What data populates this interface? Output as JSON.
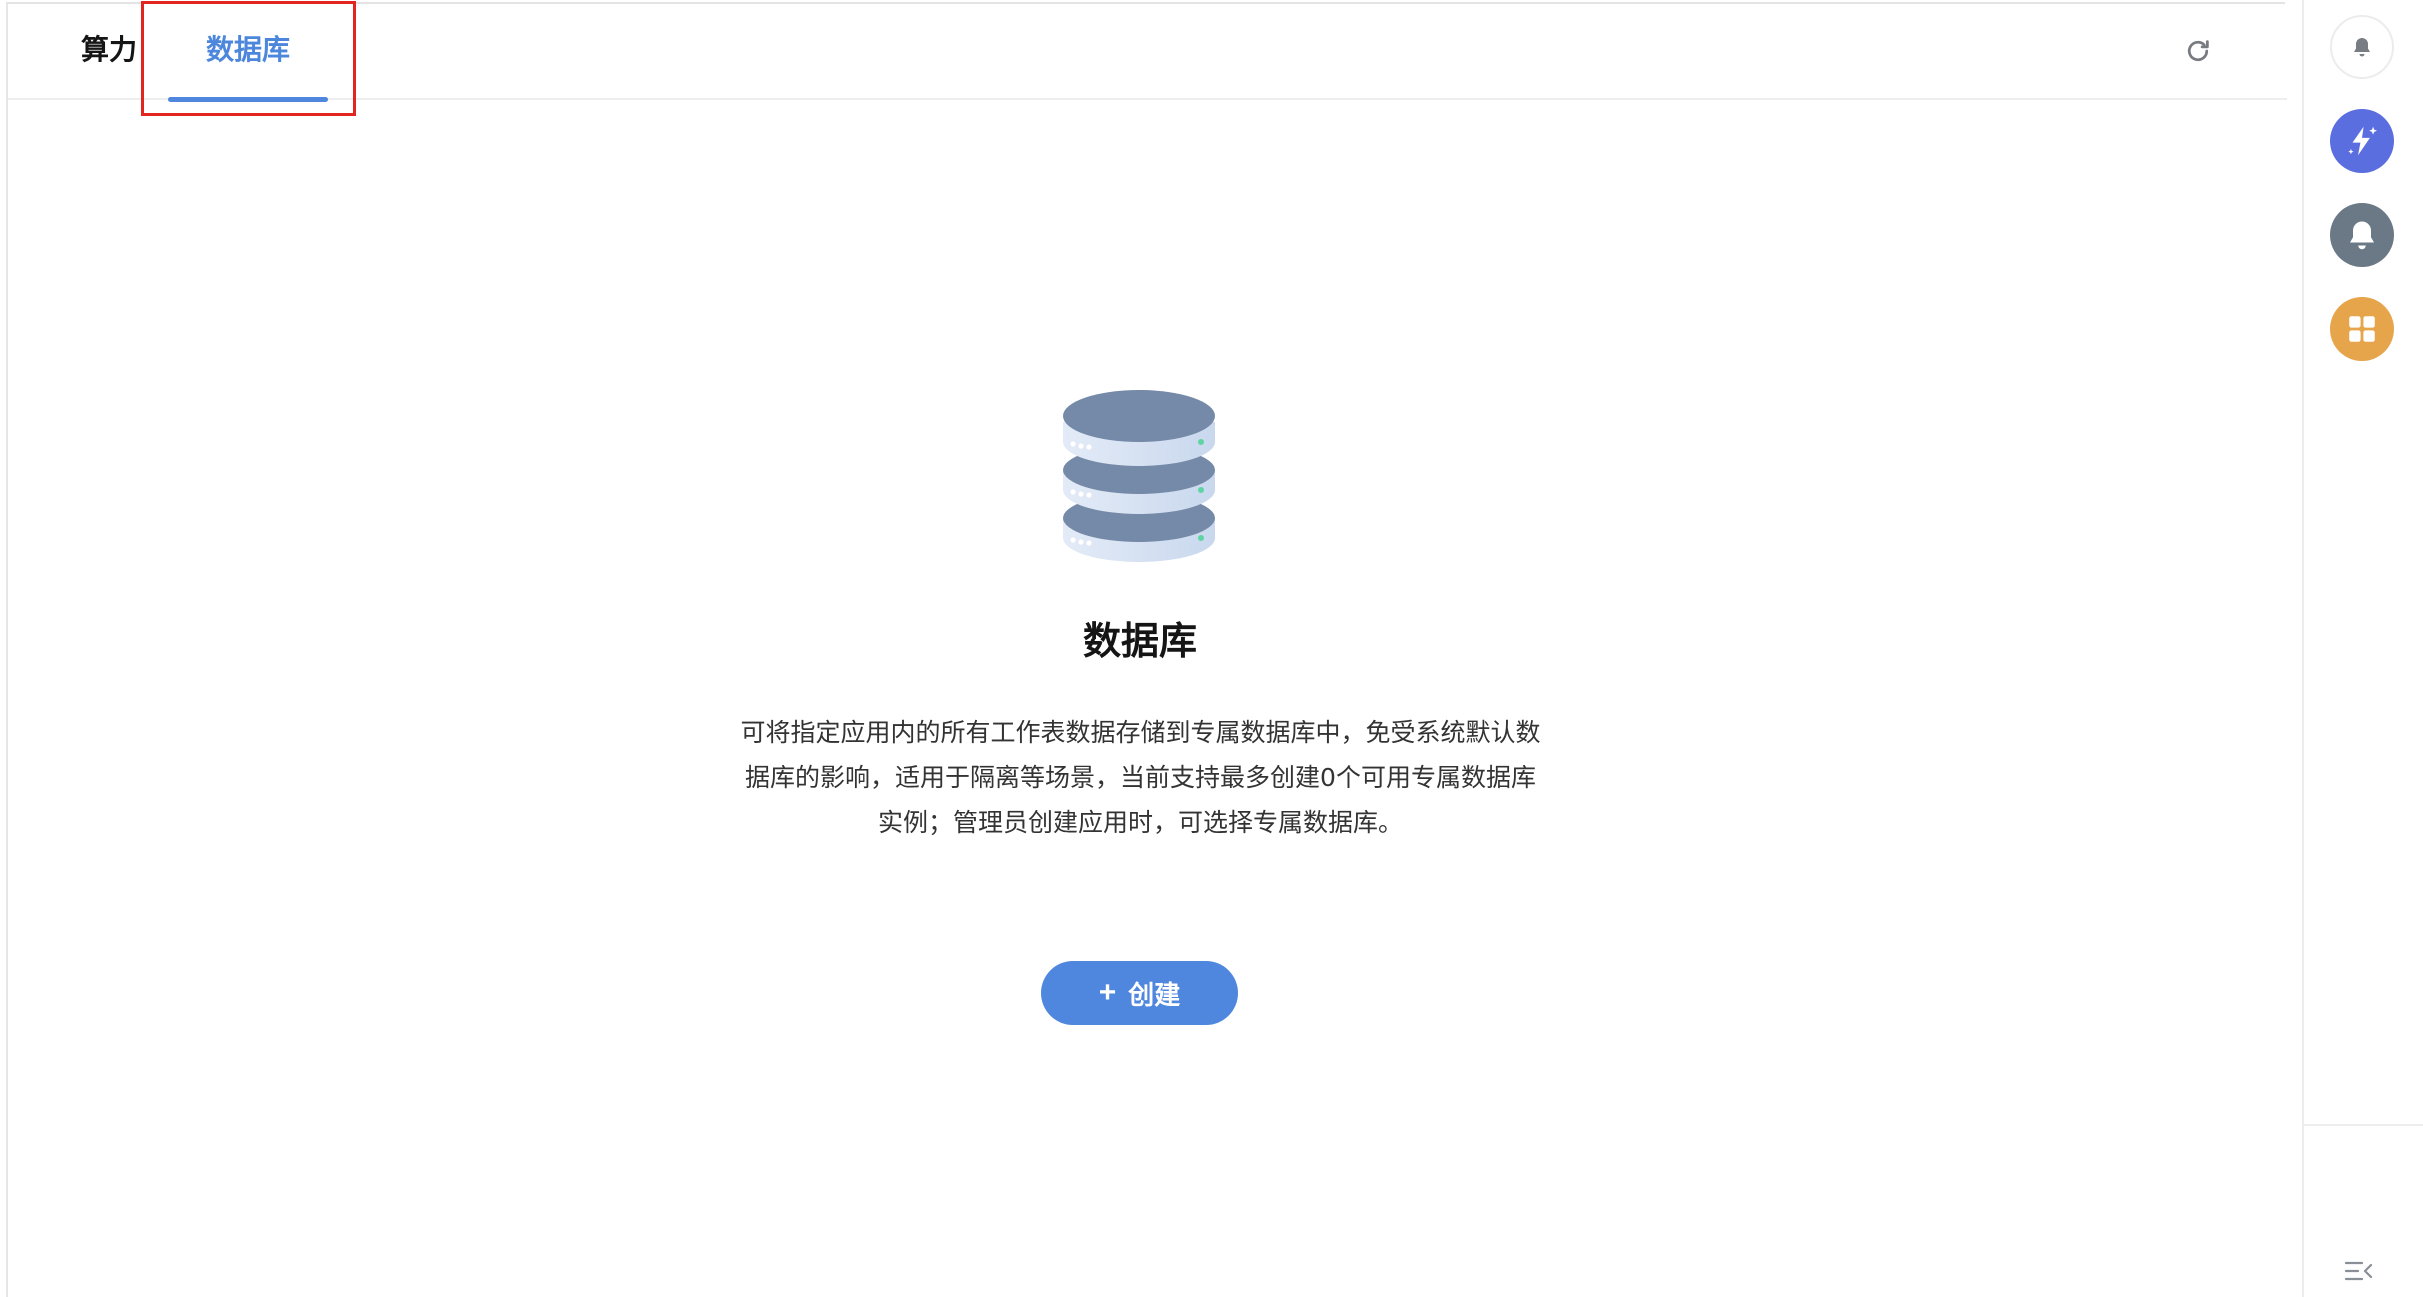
{
  "tabs": [
    {
      "label": "算力",
      "active": false
    },
    {
      "label": "数据库",
      "active": true
    }
  ],
  "empty_state": {
    "title": "数据库",
    "description_lines": [
      "可将指定应用内的所有工作表数据存储到专属数据库中，免受系统默认数",
      "据库的影响，适用于隔离等场景，当前支持最多创建0个可用专属数据库",
      "实例；管理员创建应用时，可选择专属数据库。"
    ],
    "create_button": {
      "icon": "+",
      "label": "创建"
    }
  },
  "icons": {
    "refresh": "refresh-icon",
    "notification": "bell-icon",
    "ai_assistant": "sparkle-bolt-icon",
    "message": "bell-icon",
    "apps": "grid-icon",
    "collapse": "collapse-menu-icon"
  },
  "colors": {
    "accent": "#4f86de",
    "highlight_box": "#e2261f",
    "ai_button": "#5b6ee0",
    "bell_button": "#6b7986",
    "apps_button": "#e6a54a"
  }
}
